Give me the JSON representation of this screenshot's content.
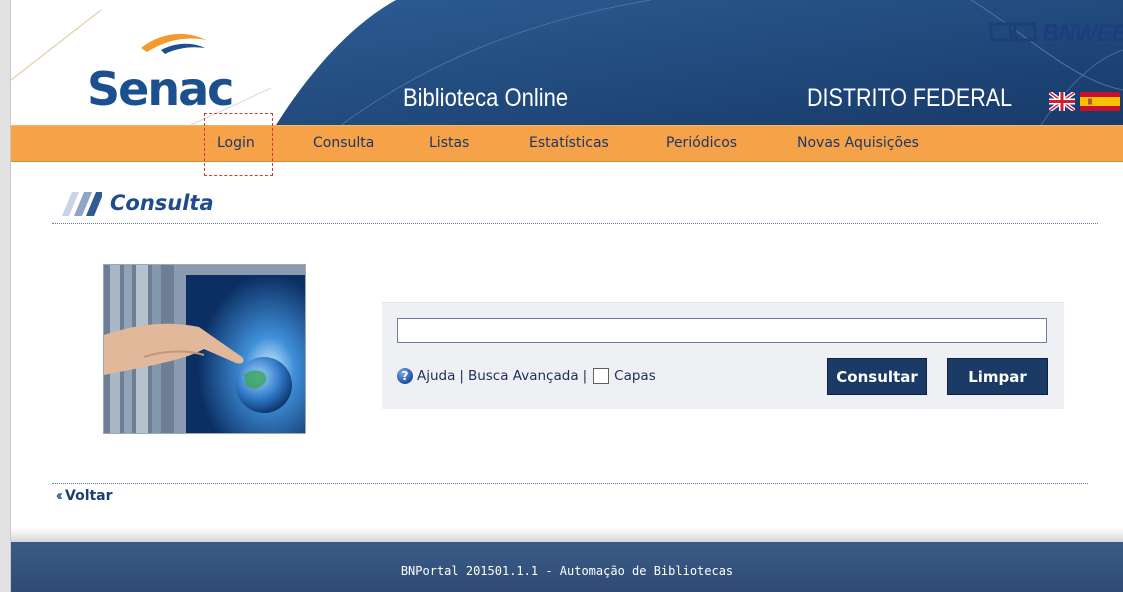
{
  "header": {
    "logo_text": "Senac",
    "site_title": "Biblioteca Online",
    "region": "DISTRITO FEDERAL",
    "brand": "BNWEB",
    "languages": [
      "flag-uk-icon",
      "flag-es-icon"
    ]
  },
  "nav": {
    "items": [
      {
        "label": "Login"
      },
      {
        "label": "Consulta"
      },
      {
        "label": "Listas"
      },
      {
        "label": "Estatísticas"
      },
      {
        "label": "Periódicos"
      },
      {
        "label": "Novas Aquisições"
      }
    ]
  },
  "main": {
    "title": "Consulta",
    "search": {
      "value": "",
      "help_label": "Ajuda",
      "separator": "|",
      "advanced_label": "Busca Avançada",
      "covers_label": "Capas",
      "covers_checked": false,
      "search_button": "Consultar",
      "clear_button": "Limpar"
    },
    "back_label": "Voltar"
  },
  "footer": {
    "text": "BNPortal 201501.1.1 - Automação de Bibliotecas"
  },
  "colors": {
    "header_blue": "#1e4677",
    "navbar_orange": "#f6a248",
    "button_navy": "#1b3a66",
    "footer_blue": "#34527d",
    "login_highlight": "#d23a3a"
  }
}
